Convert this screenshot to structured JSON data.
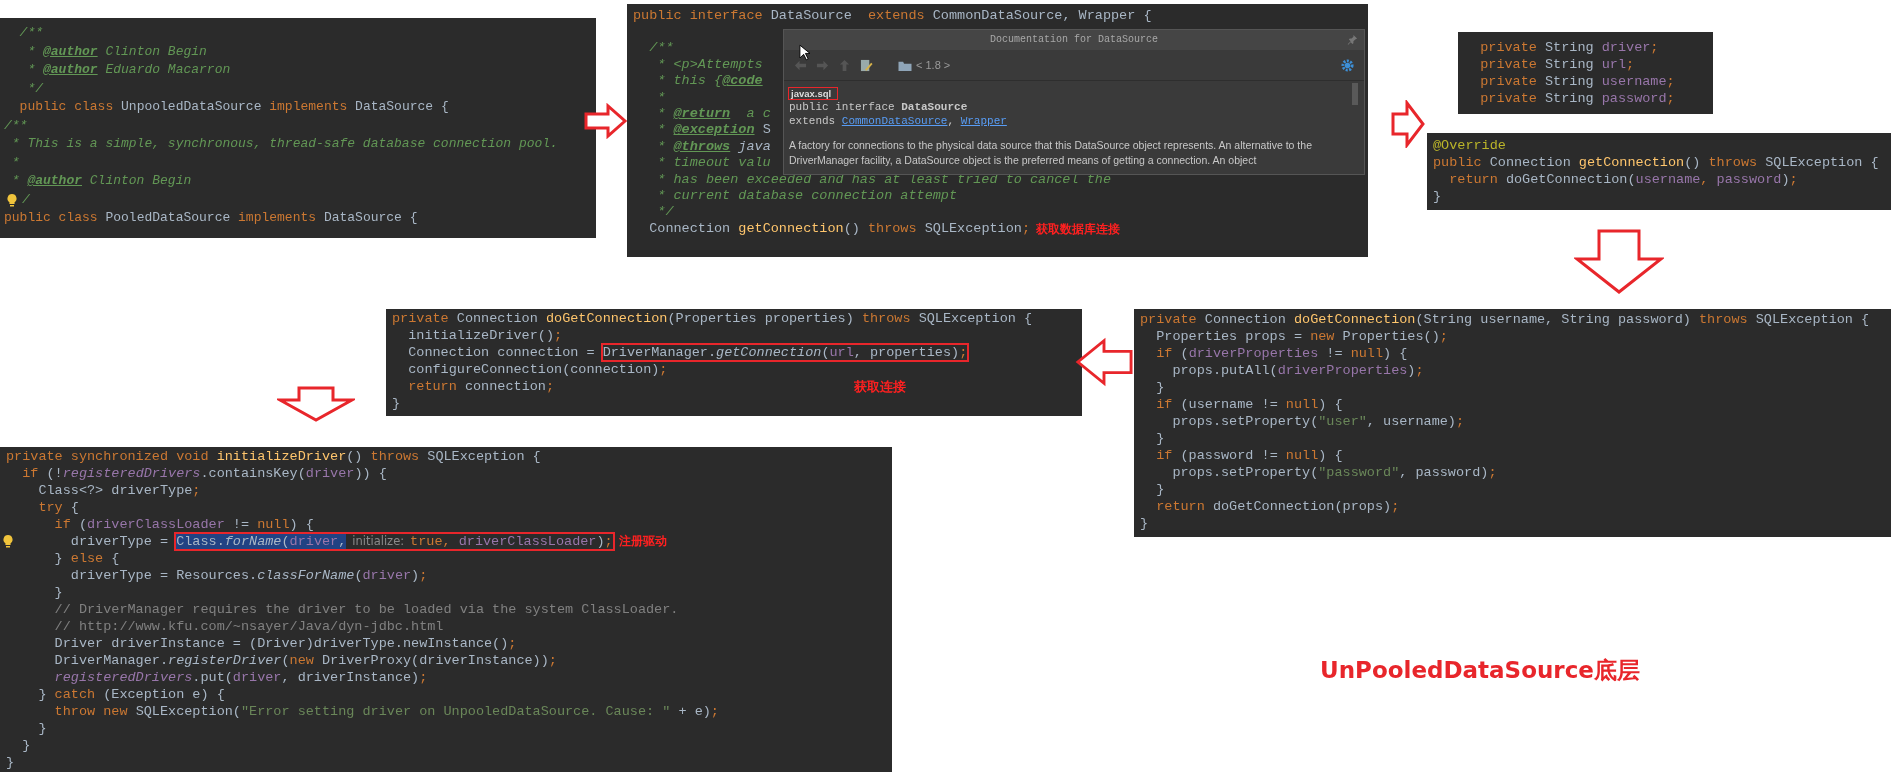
{
  "panels": [
    {
      "lines": [
        {
          "tokens": [
            {
              "text": "  /**",
              "kind": "doc"
            }
          ]
        },
        {
          "tokens": [
            {
              "text": "   * ",
              "kind": "doc"
            },
            {
              "text": "@author",
              "kind": "doctag"
            },
            {
              "text": " Clinton Begin",
              "kind": "doc"
            }
          ]
        },
        {
          "tokens": [
            {
              "text": "   * ",
              "kind": "doc"
            },
            {
              "text": "@author",
              "kind": "doctag"
            },
            {
              "text": " Eduardo Macarron",
              "kind": "doc"
            }
          ]
        },
        {
          "tokens": [
            {
              "text": "   */",
              "kind": "doc"
            }
          ]
        },
        {
          "tokens": [
            {
              "text": "  public class ",
              "kind": "kw"
            },
            {
              "text": "UnpooledDataSource",
              "kind": "plain"
            },
            {
              "text": " implements ",
              "kind": "kw"
            },
            {
              "text": "DataSource {",
              "kind": "plain"
            }
          ]
        },
        {
          "tokens": [
            {
              "text": "/**",
              "kind": "doc"
            }
          ]
        },
        {
          "tokens": [
            {
              "text": " * This is a simple, synchronous, thread-safe database connection pool.",
              "kind": "doc"
            }
          ]
        },
        {
          "tokens": [
            {
              "text": " *",
              "kind": "doc"
            }
          ]
        },
        {
          "tokens": [
            {
              "text": " * ",
              "kind": "doc"
            },
            {
              "text": "@author",
              "kind": "doctag"
            },
            {
              "text": " Clinton Begin",
              "kind": "doc"
            }
          ]
        },
        {
          "tokens": [
            {
              "text": "/",
              "kind": "doc"
            }
          ]
        },
        {
          "tokens": [
            {
              "text": "public class ",
              "kind": "kw"
            },
            {
              "text": "PooledDataSource",
              "kind": "plain"
            },
            {
              "text": " implements ",
              "kind": "kw"
            },
            {
              "text": "DataSource {",
              "kind": "plain"
            }
          ]
        }
      ]
    },
    {
      "lines": [
        {
          "tokens": [
            {
              "text": "public interface ",
              "kind": "kw"
            },
            {
              "text": "DataSource",
              "kind": "plain"
            },
            {
              "text": "  extends ",
              "kind": "kw"
            },
            {
              "text": "CommonDataSource, Wrapper {",
              "kind": "plain"
            }
          ]
        },
        {
          "tokens": [
            {
              "text": "  /**",
              "kind": "doc"
            }
          ]
        },
        {
          "tokens": [
            {
              "text": "   * <p>Attempts",
              "kind": "doc"
            }
          ]
        },
        {
          "tokens": [
            {
              "text": "   * this {",
              "kind": "doc"
            },
            {
              "text": "@code",
              "kind": "doctag"
            }
          ]
        },
        {
          "tokens": [
            {
              "text": "   *",
              "kind": "doc"
            }
          ]
        },
        {
          "tokens": [
            {
              "text": "   * ",
              "kind": "doc"
            },
            {
              "text": "@return",
              "kind": "doctag"
            },
            {
              "text": "  a c",
              "kind": "doc"
            }
          ]
        },
        {
          "tokens": [
            {
              "text": "   * ",
              "kind": "doc"
            },
            {
              "text": "@exception",
              "kind": "doctag"
            },
            {
              "text": " S",
              "kind": "plain"
            }
          ]
        },
        {
          "tokens": [
            {
              "text": "   * ",
              "kind": "doc"
            },
            {
              "text": "@throws",
              "kind": "doctag"
            },
            {
              "text": " java",
              "kind": "italic"
            }
          ]
        },
        {
          "tokens": [
            {
              "text": "   * timeout valu",
              "kind": "doc"
            }
          ]
        },
        {
          "tokens": [
            {
              "text": "   * has been exceeded and has at least tried to cancel the",
              "kind": "doc"
            }
          ]
        },
        {
          "tokens": [
            {
              "text": "   * current database connection attempt",
              "kind": "doc"
            }
          ]
        },
        {
          "tokens": [
            {
              "text": "   */",
              "kind": "doc"
            }
          ]
        },
        {
          "tokens": [
            {
              "text": "  Connection ",
              "kind": "plain"
            },
            {
              "text": "getConnection",
              "kind": "fn"
            },
            {
              "text": "() ",
              "kind": "plain"
            },
            {
              "text": "throws ",
              "kind": "kw"
            },
            {
              "text": "SQLException",
              "kind": "plain"
            },
            {
              "text": ";",
              "kind": "kw"
            }
          ],
          "note": "获取数据库连接"
        }
      ],
      "doc_popup": {
        "title": "Documentation for DataSource",
        "version": "< 1.8 >",
        "package": "javax.sql",
        "signature": "public interface **DataSource**",
        "extends": [
          {
            "text": "extends ",
            "kind": "plain"
          },
          {
            "text": "CommonDataSource",
            "kind": "link"
          },
          {
            "text": ", ",
            "kind": "plain"
          },
          {
            "text": "Wrapper",
            "kind": "link"
          }
        ],
        "description": "A factory for connections to the physical data source that this DataSource object represents. An alternative to the DriverManager facility, a DataSource object is the preferred means of getting a connection. An object"
      }
    },
    {
      "lines": [
        {
          "tokens": [
            {
              "text": "  private ",
              "kind": "kw"
            },
            {
              "text": "String ",
              "kind": "plain"
            },
            {
              "text": "driver",
              "kind": "field"
            },
            {
              "text": ";",
              "kind": "kw"
            }
          ]
        },
        {
          "tokens": [
            {
              "text": "  private ",
              "kind": "kw"
            },
            {
              "text": "String ",
              "kind": "plain"
            },
            {
              "text": "url",
              "kind": "field"
            },
            {
              "text": ";",
              "kind": "kw"
            }
          ]
        },
        {
          "tokens": [
            {
              "text": "  private ",
              "kind": "kw"
            },
            {
              "text": "String ",
              "kind": "plain"
            },
            {
              "text": "username",
              "kind": "field"
            },
            {
              "text": ";",
              "kind": "kw"
            }
          ]
        },
        {
          "tokens": [
            {
              "text": "  private ",
              "kind": "kw"
            },
            {
              "text": "String ",
              "kind": "plain"
            },
            {
              "text": "password",
              "kind": "field"
            },
            {
              "text": ";",
              "kind": "kw"
            }
          ]
        }
      ]
    },
    {
      "lines": [
        {
          "tokens": [
            {
              "text": "@Override",
              "kind": "annotation"
            }
          ]
        },
        {
          "tokens": [
            {
              "text": "public ",
              "kind": "kw"
            },
            {
              "text": "Connection ",
              "kind": "plain"
            },
            {
              "text": "getConnection",
              "kind": "fn"
            },
            {
              "text": "() ",
              "kind": "plain"
            },
            {
              "text": "throws ",
              "kind": "kw"
            },
            {
              "text": "SQLException {",
              "kind": "plain"
            }
          ]
        },
        {
          "tokens": [
            {
              "text": "  return ",
              "kind": "kw"
            },
            {
              "text": "doGetConnection(",
              "kind": "plain"
            },
            {
              "text": "username",
              "kind": "field"
            },
            {
              "text": ", ",
              "kind": "kw"
            },
            {
              "text": "password",
              "kind": "field"
            },
            {
              "text": ")",
              "kind": "plain"
            },
            {
              "text": ";",
              "kind": "kw"
            }
          ]
        },
        {
          "tokens": [
            {
              "text": "}",
              "kind": "plain"
            }
          ]
        }
      ]
    },
    {
      "lines": [
        {
          "tokens": [
            {
              "text": "private ",
              "kind": "kw"
            },
            {
              "text": "Connection ",
              "kind": "plain"
            },
            {
              "text": "doGetConnection",
              "kind": "fn"
            },
            {
              "text": "(Properties properties) ",
              "kind": "plain"
            },
            {
              "text": "throws ",
              "kind": "kw"
            },
            {
              "text": "SQLException {",
              "kind": "plain"
            }
          ]
        },
        {
          "tokens": [
            {
              "text": "  initializeDriver()",
              "kind": "plain"
            },
            {
              "text": ";",
              "kind": "kw"
            }
          ]
        },
        {
          "tokens": [
            {
              "text": "  Connection connection = ",
              "kind": "plain"
            }
          ],
          "boxed": [
            {
              "text": "DriverManager.",
              "kind": "plain"
            },
            {
              "text": "getConnection",
              "kind": "italic"
            },
            {
              "text": "(",
              "kind": "plain"
            },
            {
              "text": "url",
              "kind": "field"
            },
            {
              "text": ", properties)",
              "kind": "plain"
            },
            {
              "text": ";",
              "kind": "kw"
            }
          ]
        },
        {
          "tokens": [
            {
              "text": "  configureConnection(connection)",
              "kind": "plain"
            },
            {
              "text": ";",
              "kind": "kw"
            }
          ]
        },
        {
          "tokens": [
            {
              "text": "  return ",
              "kind": "kw"
            },
            {
              "text": "connection",
              "kind": "plain"
            },
            {
              "text": ";",
              "kind": "kw"
            }
          ],
          "note": "获取连接"
        },
        {
          "tokens": [
            {
              "text": "}",
              "kind": "plain"
            }
          ]
        }
      ]
    },
    {
      "lines": [
        {
          "tokens": [
            {
              "text": "private ",
              "kind": "kw"
            },
            {
              "text": "Connection ",
              "kind": "plain"
            },
            {
              "text": "doGetConnection",
              "kind": "fn"
            },
            {
              "text": "(String username, String password) ",
              "kind": "plain"
            },
            {
              "text": "throws ",
              "kind": "kw"
            },
            {
              "text": "SQLException {",
              "kind": "plain"
            }
          ]
        },
        {
          "tokens": [
            {
              "text": "  Properties props = ",
              "kind": "plain"
            },
            {
              "text": "new ",
              "kind": "kw"
            },
            {
              "text": "Properties()",
              "kind": "plain"
            },
            {
              "text": ";",
              "kind": "kw"
            }
          ]
        },
        {
          "tokens": [
            {
              "text": "  if ",
              "kind": "kw"
            },
            {
              "text": "(",
              "kind": "plain"
            },
            {
              "text": "driverProperties",
              "kind": "field"
            },
            {
              "text": " != ",
              "kind": "plain"
            },
            {
              "text": "null",
              "kind": "kw"
            },
            {
              "text": ") {",
              "kind": "plain"
            }
          ]
        },
        {
          "tokens": [
            {
              "text": "    props.putAll(",
              "kind": "plain"
            },
            {
              "text": "driverProperties",
              "kind": "field"
            },
            {
              "text": ")",
              "kind": "plain"
            },
            {
              "text": ";",
              "kind": "kw"
            }
          ]
        },
        {
          "tokens": [
            {
              "text": "  }",
              "kind": "plain"
            }
          ]
        },
        {
          "tokens": [
            {
              "text": "  if ",
              "kind": "kw"
            },
            {
              "text": "(username != ",
              "kind": "plain"
            },
            {
              "text": "null",
              "kind": "kw"
            },
            {
              "text": ") {",
              "kind": "plain"
            }
          ]
        },
        {
          "tokens": [
            {
              "text": "    props.setProperty(",
              "kind": "plain"
            },
            {
              "text": "\"user\"",
              "kind": "string"
            },
            {
              "text": ", username)",
              "kind": "plain"
            },
            {
              "text": ";",
              "kind": "kw"
            }
          ]
        },
        {
          "tokens": [
            {
              "text": "  }",
              "kind": "plain"
            }
          ]
        },
        {
          "tokens": [
            {
              "text": "  if ",
              "kind": "kw"
            },
            {
              "text": "(password != ",
              "kind": "plain"
            },
            {
              "text": "null",
              "kind": "kw"
            },
            {
              "text": ") {",
              "kind": "plain"
            }
          ]
        },
        {
          "tokens": [
            {
              "text": "    props.setProperty(",
              "kind": "plain"
            },
            {
              "text": "\"password\"",
              "kind": "string"
            },
            {
              "text": ", password)",
              "kind": "plain"
            },
            {
              "text": ";",
              "kind": "kw"
            }
          ]
        },
        {
          "tokens": [
            {
              "text": "  }",
              "kind": "plain"
            }
          ]
        },
        {
          "tokens": [
            {
              "text": "  return ",
              "kind": "kw"
            },
            {
              "text": "doGetConnection(props)",
              "kind": "plain"
            },
            {
              "text": ";",
              "kind": "kw"
            }
          ]
        },
        {
          "tokens": [
            {
              "text": "}",
              "kind": "plain"
            }
          ]
        }
      ]
    },
    {
      "lines": [
        {
          "tokens": [
            {
              "text": "private synchronized void ",
              "kind": "kw"
            },
            {
              "text": "initializeDriver",
              "kind": "fn"
            },
            {
              "text": "() ",
              "kind": "plain"
            },
            {
              "text": "throws ",
              "kind": "kw"
            },
            {
              "text": "SQLException {",
              "kind": "plain"
            }
          ]
        },
        {
          "tokens": [
            {
              "text": "  if ",
              "kind": "kw"
            },
            {
              "text": "(!",
              "kind": "plain"
            },
            {
              "text": "registeredDrivers",
              "kind": "ifield"
            },
            {
              "text": ".containsKey(",
              "kind": "plain"
            },
            {
              "text": "driver",
              "kind": "field"
            },
            {
              "text": ")) {",
              "kind": "plain"
            }
          ]
        },
        {
          "tokens": [
            {
              "text": "    Class<?> driverType",
              "kind": "plain"
            },
            {
              "text": ";",
              "kind": "kw"
            }
          ]
        },
        {
          "tokens": [
            {
              "text": "    try ",
              "kind": "kw"
            },
            {
              "text": "{",
              "kind": "plain"
            }
          ]
        },
        {
          "tokens": [
            {
              "text": "      if ",
              "kind": "kw"
            },
            {
              "text": "(",
              "kind": "plain"
            },
            {
              "text": "driverClassLoader",
              "kind": "field"
            },
            {
              "text": " != ",
              "kind": "plain"
            },
            {
              "text": "null",
              "kind": "kw"
            },
            {
              "text": ") {",
              "kind": "plain"
            }
          ]
        },
        {
          "tokens": [
            {
              "text": "        driverType = ",
              "kind": "plain"
            }
          ],
          "boxed": [
            {
              "text": "Class.",
              "kind": "sel"
            },
            {
              "text": "forName",
              "kind": "sel-italic"
            },
            {
              "text": "(",
              "kind": "sel"
            },
            {
              "text": "driver",
              "kind": "sel-field"
            },
            {
              "text": ",",
              "kind": "sel"
            },
            {
              "text": "initialize:",
              "kind": "hint"
            },
            {
              "text": "true",
              "kind": "kw"
            },
            {
              "text": ", ",
              "kind": "kw"
            },
            {
              "text": "driverClassLoader",
              "kind": "field"
            },
            {
              "text": ")",
              "kind": "plain"
            },
            {
              "text": ";",
              "kind": "kw"
            }
          ],
          "note": "注册驱动"
        },
        {
          "tokens": [
            {
              "text": "      } ",
              "kind": "plain"
            },
            {
              "text": "else ",
              "kind": "kw"
            },
            {
              "text": "{",
              "kind": "plain"
            }
          ]
        },
        {
          "tokens": [
            {
              "text": "        driverType = Resources.",
              "kind": "plain"
            },
            {
              "text": "classForName",
              "kind": "italic"
            },
            {
              "text": "(",
              "kind": "plain"
            },
            {
              "text": "driver",
              "kind": "field"
            },
            {
              "text": ")",
              "kind": "plain"
            },
            {
              "text": ";",
              "kind": "kw"
            }
          ]
        },
        {
          "tokens": [
            {
              "text": "      }",
              "kind": "plain"
            }
          ]
        },
        {
          "tokens": [
            {
              "text": "      // DriverManager requires the driver to be loaded via the system ClassLoader.",
              "kind": "comment"
            }
          ]
        },
        {
          "tokens": [
            {
              "text": "      // http://www.kfu.com/~nsayer/Java/dyn-jdbc.html",
              "kind": "comment"
            }
          ]
        },
        {
          "tokens": [
            {
              "text": "      Driver driverInstance = (Driver)driverType.newInstance()",
              "kind": "plain"
            },
            {
              "text": ";",
              "kind": "kw"
            }
          ]
        },
        {
          "tokens": [
            {
              "text": "      DriverManager.",
              "kind": "plain"
            },
            {
              "text": "registerDriver",
              "kind": "italic"
            },
            {
              "text": "(",
              "kind": "plain"
            },
            {
              "text": "new ",
              "kind": "kw"
            },
            {
              "text": "DriverProxy(driverInstance))",
              "kind": "plain"
            },
            {
              "text": ";",
              "kind": "kw"
            }
          ]
        },
        {
          "tokens": [
            {
              "text": "      registeredDrivers",
              "kind": "ifield"
            },
            {
              "text": ".put(",
              "kind": "plain"
            },
            {
              "text": "driver",
              "kind": "field"
            },
            {
              "text": ", driverInstance)",
              "kind": "plain"
            },
            {
              "text": ";",
              "kind": "kw"
            }
          ]
        },
        {
          "tokens": [
            {
              "text": "    } ",
              "kind": "plain"
            },
            {
              "text": "catch ",
              "kind": "kw"
            },
            {
              "text": "(Exception e) {",
              "kind": "plain"
            }
          ]
        },
        {
          "tokens": [
            {
              "text": "      throw new ",
              "kind": "kw"
            },
            {
              "text": "SQLException(",
              "kind": "plain"
            },
            {
              "text": "\"Error setting driver on UnpooledDataSource. Cause: \"",
              "kind": "string"
            },
            {
              "text": " + e)",
              "kind": "plain"
            },
            {
              "text": ";",
              "kind": "kw"
            }
          ]
        },
        {
          "tokens": [
            {
              "text": "    }",
              "kind": "plain"
            }
          ]
        },
        {
          "tokens": [
            {
              "text": "  }",
              "kind": "plain"
            }
          ]
        },
        {
          "tokens": [
            {
              "text": "}",
              "kind": "plain"
            }
          ]
        }
      ]
    }
  ],
  "caption": "UnPooledDataSource底层"
}
